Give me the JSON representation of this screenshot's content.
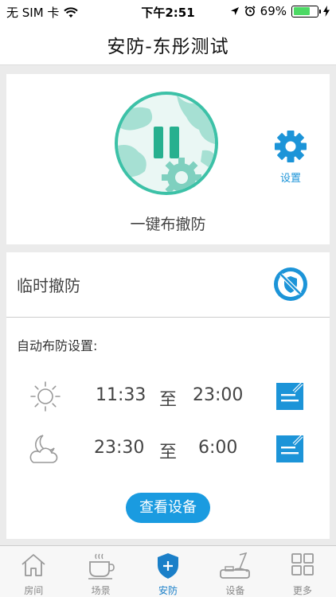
{
  "status_bar": {
    "carrier": "无 SIM 卡",
    "time": "下午2:51",
    "battery": "69%",
    "battery_level": 0.69
  },
  "header": {
    "title": "安防-东彤测试"
  },
  "arm": {
    "label": "一键布撤防",
    "settings_label": "设置"
  },
  "temp_disarm": {
    "label": "临时撤防"
  },
  "auto_arm": {
    "title": "自动布防设置:",
    "schedules": [
      {
        "icon": "sun-icon",
        "start": "11:33",
        "sep": "至",
        "end": "23:00"
      },
      {
        "icon": "moon-cloud-icon",
        "start": "23:30",
        "sep": "至",
        "end": "6:00"
      }
    ]
  },
  "view_devices_label": "查看设备",
  "tabs": [
    {
      "label": "房间",
      "icon": "home-icon"
    },
    {
      "label": "场景",
      "icon": "coffee-cup-icon"
    },
    {
      "label": "安防",
      "icon": "shield-plus-icon",
      "active": true
    },
    {
      "label": "设备",
      "icon": "device-icon"
    },
    {
      "label": "更多",
      "icon": "grid-icon"
    }
  ],
  "colors": {
    "accent": "#1a9be0",
    "teal": "#3cc1a7",
    "active_tab": "#1a7fc8"
  }
}
